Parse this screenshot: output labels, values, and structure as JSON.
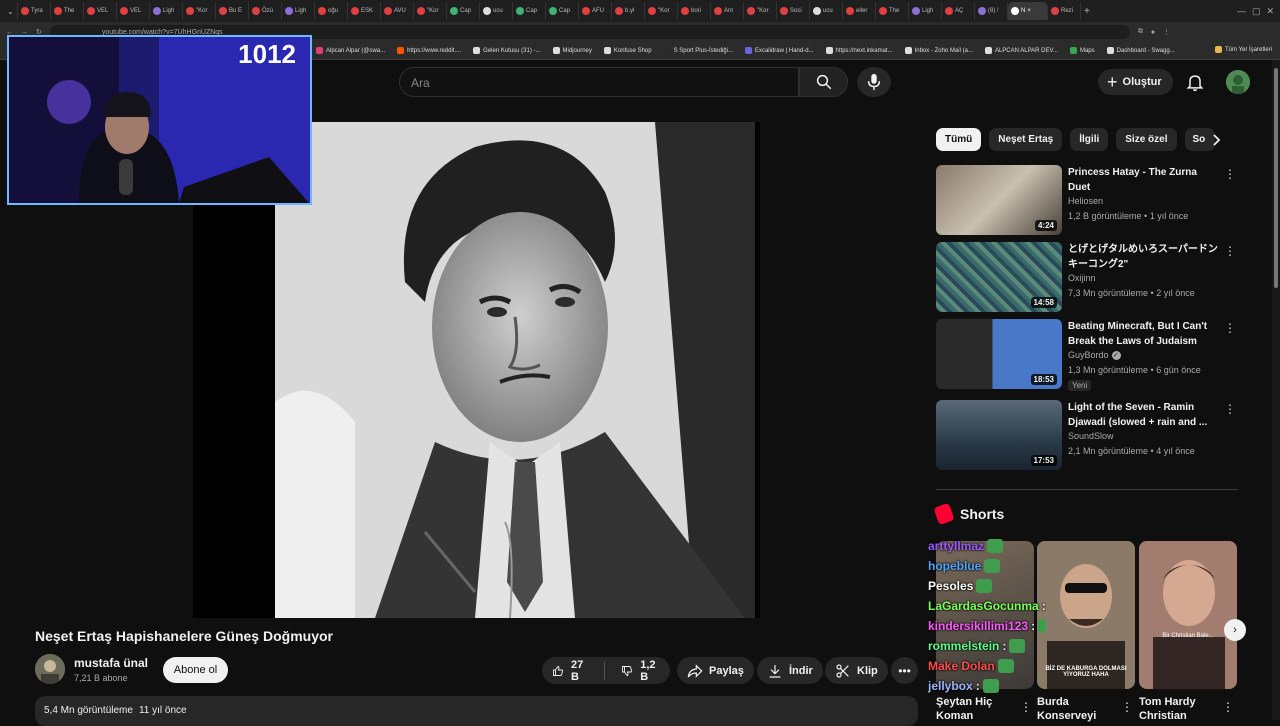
{
  "browser": {
    "tabs": [
      {
        "label": "Tyra",
        "color": "#e04040"
      },
      {
        "label": "The",
        "color": "#e04040"
      },
      {
        "label": "VEL",
        "color": "#e04040"
      },
      {
        "label": "VEL",
        "color": "#e04040"
      },
      {
        "label": "Ligh",
        "color": "#8a6fd6"
      },
      {
        "label": "\"Kor",
        "color": "#e04040"
      },
      {
        "label": "Bu E",
        "color": "#e04040"
      },
      {
        "label": "Özü",
        "color": "#e04040"
      },
      {
        "label": "Ligh",
        "color": "#8a6fd6"
      },
      {
        "label": "oğu",
        "color": "#e04040"
      },
      {
        "label": "ESK",
        "color": "#e04040"
      },
      {
        "label": "AVU",
        "color": "#e04040"
      },
      {
        "label": "\"Kor",
        "color": "#e04040"
      },
      {
        "label": "Cap",
        "color": "#3cb371"
      },
      {
        "label": "ucu",
        "color": "#dddddd"
      },
      {
        "label": "Cap",
        "color": "#3cb371"
      },
      {
        "label": "Cap",
        "color": "#3cb371"
      },
      {
        "label": "AFU",
        "color": "#e04040"
      },
      {
        "label": "b.yl",
        "color": "#e04040"
      },
      {
        "label": "\"Kor",
        "color": "#e04040"
      },
      {
        "label": "bori",
        "color": "#e04040"
      },
      {
        "label": "Ant",
        "color": "#e04040"
      },
      {
        "label": "\"Kor",
        "color": "#e04040"
      },
      {
        "label": "Soci",
        "color": "#e04040"
      },
      {
        "label": "ucu",
        "color": "#dddddd"
      },
      {
        "label": "eller",
        "color": "#e04040"
      },
      {
        "label": "The",
        "color": "#e04040"
      },
      {
        "label": "Ligh",
        "color": "#8a6fd6"
      },
      {
        "label": "AÇ",
        "color": "#e04040"
      },
      {
        "label": "(8) !",
        "color": "#8a6fd6"
      }
    ],
    "active_tab": "N",
    "new_tab_label": "+",
    "last_tab": "Rezi",
    "url": "youtube.com/watch?v=7UhHGnUZNqs",
    "bookmarks": [
      {
        "label": "Alpcan Alpar (@swa...",
        "color": "#e04070"
      },
      {
        "label": "https://www.reddit....",
        "color": "#ff5500"
      },
      {
        "label": "Gelen Kutusu (31) -...",
        "color": "#dddddd"
      },
      {
        "label": "Midjourney",
        "color": "#dddddd"
      },
      {
        "label": "Konfuse Shop",
        "color": "#dddddd"
      },
      {
        "label": "S Sport Plus-İstediği...",
        "color": "#2a2a2a"
      },
      {
        "label": "Excalidraw | Hand-d...",
        "color": "#6965db"
      },
      {
        "label": "https://next.inkamat...",
        "color": "#dddddd"
      },
      {
        "label": "Inbox - Zoho Mail (a...",
        "color": "#dddddd"
      },
      {
        "label": "ALPCAN ALPAR DEV...",
        "color": "#dddddd"
      },
      {
        "label": "Maps",
        "color": "#34a853"
      },
      {
        "label": "Dashboard - Swagg...",
        "color": "#dddddd"
      }
    ],
    "all_bookmarks": "Tüm Yer İşaretleri"
  },
  "header": {
    "search_placeholder": "Ara",
    "create_label": "Oluştur"
  },
  "stream_overlay": {
    "counter": "1012"
  },
  "video": {
    "title": "Neşet Ertaş Hapishanelere Güneş Doğmuyor",
    "channel_name": "mustafa ünal",
    "subscribers": "7,21 B abone",
    "subscribe_label": "Abone ol",
    "likes": "27 B",
    "dislikes": "1,2 B",
    "share_label": "Paylaş",
    "download_label": "İndir",
    "clip_label": "Klip",
    "views": "5,4 Mn görüntüleme",
    "age": "11 yıl önce"
  },
  "chips": [
    "Tümü",
    "Neşet Ertaş",
    "İlgili",
    "Size özel",
    "So"
  ],
  "recommendations": [
    {
      "title": "Princess Hatay - The Zurna Duet",
      "channel": "Heliosen",
      "verified": false,
      "meta": "1,2 B görüntüleme • 1 yıl önce",
      "duration": "4:24",
      "badge": ""
    },
    {
      "title": "とげとげタルめいろスーパードンキーコング2\"",
      "channel": "Oxijinn",
      "verified": false,
      "meta": "7,3 Mn görüntüleme • 2 yıl önce",
      "duration": "14:58",
      "badge": ""
    },
    {
      "title": "Beating Minecraft, But I Can't Break the Laws of Judaism",
      "channel": "GuyBordo",
      "verified": true,
      "meta": "1,3 Mn görüntüleme • 6 gün önce",
      "duration": "18:53",
      "badge": "Yeni"
    },
    {
      "title": "Light of the Seven - Ramin Djawadi (slowed + rain and ...",
      "channel": "SoundSlow",
      "verified": false,
      "meta": "2,1 Mn görüntüleme • 4 yıl önce",
      "duration": "17:53",
      "badge": ""
    }
  ],
  "shorts": {
    "header": "Shorts",
    "items": [
      {
        "title": "Şeytan Hiç Koman"
      },
      {
        "title": "Burda Konserveyi"
      },
      {
        "title": "Tom Hardy Christian"
      }
    ],
    "short2_caption": "BİZ DE KABURGA DOLMASI YİYORUZ HAHA",
    "short3_caption": "Bir Christian Bale..."
  },
  "chat_overlay": [
    {
      "user": "arttyllmaz",
      "color": "#9b59ff",
      "msg": ""
    },
    {
      "user": "hopeblue",
      "color": "#4da6ff",
      "msg": ""
    },
    {
      "user": "Pesoles",
      "color": "#ffffff",
      "msg": ""
    },
    {
      "user": "LaGardasGocunma",
      "color": "#7dff5a",
      "msg": ":"
    },
    {
      "user": "kindersikillimi123",
      "color": "#ff5aff",
      "msg": ":"
    },
    {
      "user": "rommelstein",
      "color": "#5aff8a",
      "msg": ":"
    },
    {
      "user": "Make Dolan",
      "color": "#ff4d4d",
      "msg": ""
    },
    {
      "user": "jellybox",
      "color": "#9bb5ff",
      "msg": ":"
    }
  ]
}
